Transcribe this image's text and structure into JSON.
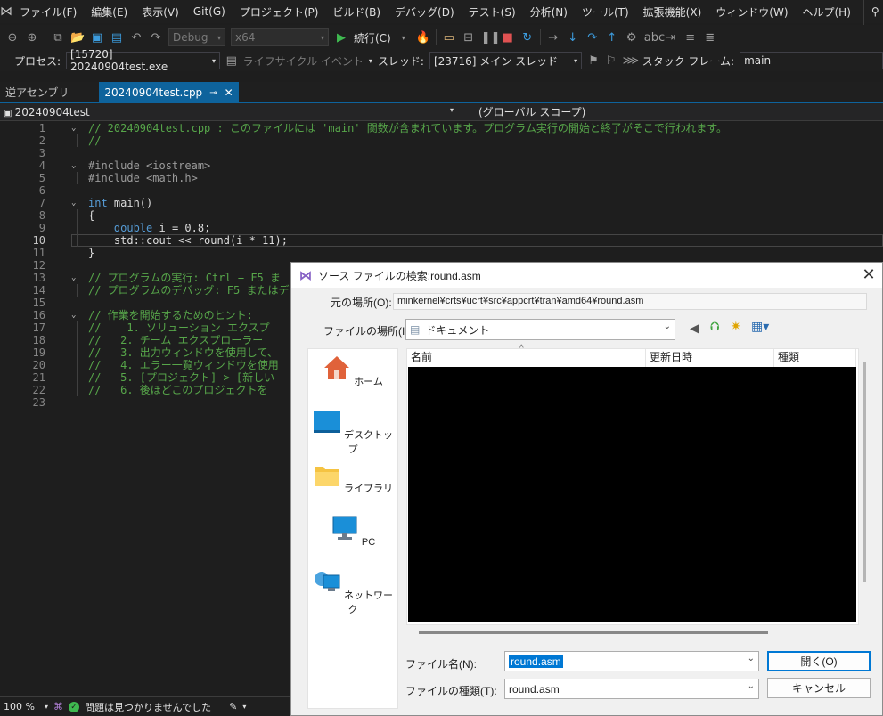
{
  "menubar": {
    "items": [
      "ファイル(F)",
      "編集(E)",
      "表示(V)",
      "Git(G)",
      "プロジェクト(P)",
      "ビルド(B)",
      "デバッグ(D)",
      "テスト(S)",
      "分析(N)",
      "ツール(T)",
      "拡張機能(X)",
      "ウィンドウ(W)",
      "ヘルプ(H)"
    ],
    "search_label": "検索"
  },
  "toolbar": {
    "config": "Debug",
    "platform": "x64",
    "continue_label": "続行(C)"
  },
  "process_bar": {
    "process_label": "プロセス:",
    "process_value": "[15720] 20240904test.exe",
    "lifecycle_label": "ライフサイクル イベント",
    "thread_label": "スレッド:",
    "thread_value": "[23716] メイン スレッド",
    "stack_label": "スタック フレーム:",
    "stack_value": "main"
  },
  "tabs": [
    {
      "label": "逆アセンブリ",
      "active": false
    },
    {
      "label": "20240904test.cpp",
      "active": true
    }
  ],
  "navbar": {
    "project": "20240904test",
    "scope": "(グローバル スコープ)"
  },
  "editor": {
    "current_line": 10,
    "lines": [
      {
        "n": "1",
        "fold": "v",
        "text": "// 20240904test.cpp : このファイルには 'main' 関数が含まれています。プログラム実行の開始と終了がそこで行われます。",
        "cls": "c-comment"
      },
      {
        "n": "2",
        "fold": "",
        "text": "//",
        "cls": "c-comment"
      },
      {
        "n": "3",
        "fold": "",
        "text": "",
        "cls": "c-plain"
      },
      {
        "n": "4",
        "fold": "v",
        "text": "#include <iostream>",
        "cls": "c-pp"
      },
      {
        "n": "5",
        "fold": "",
        "text": "#include <math.h>",
        "cls": "c-pp"
      },
      {
        "n": "6",
        "fold": "",
        "text": "",
        "cls": "c-plain"
      },
      {
        "n": "7",
        "fold": "v",
        "text": "int main()",
        "cls": "c-plain"
      },
      {
        "n": "8",
        "fold": "",
        "text": "{",
        "cls": "c-plain"
      },
      {
        "n": "9",
        "fold": "",
        "text": "    double i = 0.8;",
        "cls": "c-plain"
      },
      {
        "n": "10",
        "fold": "",
        "text": "    std::cout << round(i * 11);",
        "cls": "c-plain"
      },
      {
        "n": "11",
        "fold": "",
        "text": "}",
        "cls": "c-plain"
      },
      {
        "n": "12",
        "fold": "",
        "text": "",
        "cls": "c-plain"
      },
      {
        "n": "13",
        "fold": "v",
        "text": "// プログラムの実行: Ctrl + F5 ま",
        "cls": "c-comment"
      },
      {
        "n": "14",
        "fold": "",
        "text": "// プログラムのデバッグ: F5 またはデ",
        "cls": "c-comment"
      },
      {
        "n": "15",
        "fold": "",
        "text": "",
        "cls": "c-plain"
      },
      {
        "n": "16",
        "fold": "v",
        "text": "// 作業を開始するためのヒント:",
        "cls": "c-comment"
      },
      {
        "n": "17",
        "fold": "",
        "text": "//    1. ソリューション エクスプ",
        "cls": "c-comment"
      },
      {
        "n": "18",
        "fold": "",
        "text": "//   2. チーム エクスプローラー",
        "cls": "c-comment"
      },
      {
        "n": "19",
        "fold": "",
        "text": "//   3. 出力ウィンドウを使用して、",
        "cls": "c-comment"
      },
      {
        "n": "20",
        "fold": "",
        "text": "//   4. エラー一覧ウィンドウを使用",
        "cls": "c-comment"
      },
      {
        "n": "21",
        "fold": "",
        "text": "//   5. [プロジェクト] > [新しい",
        "cls": "c-comment"
      },
      {
        "n": "22",
        "fold": "",
        "text": "//   6. 後ほどこのプロジェクトを",
        "cls": "c-comment"
      },
      {
        "n": "23",
        "fold": "",
        "text": "",
        "cls": "c-plain"
      }
    ]
  },
  "status": {
    "zoom": "100 %",
    "issues": "問題は見つかりませんでした"
  },
  "dialog": {
    "title": "ソース ファイルの検索:round.asm",
    "orig_location_label": "元の場所(O):",
    "orig_location_value": "minkernel¥crts¥ucrt¥src¥appcrt¥tran¥amd64¥round.asm",
    "lookin_label": "ファイルの場所(I):",
    "lookin_value": "ドキュメント",
    "places": [
      "ホーム",
      "デスクトップ",
      "ライブラリ",
      "PC",
      "ネットワーク"
    ],
    "columns": [
      "名前",
      "更新日時",
      "種類"
    ],
    "filename_label": "ファイル名(N):",
    "filename_value": "round.asm",
    "filetype_label": "ファイルの種類(T):",
    "filetype_value": "round.asm",
    "open_button": "開く(O)",
    "cancel_button": "キャンセル"
  }
}
